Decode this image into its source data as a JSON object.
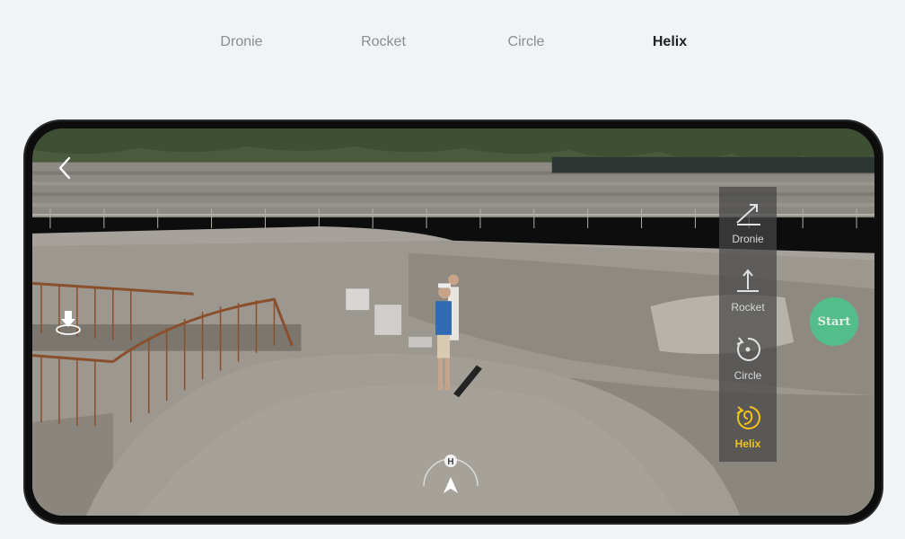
{
  "tabs": [
    {
      "label": "Dronie",
      "active": false
    },
    {
      "label": "Rocket",
      "active": false
    },
    {
      "label": "Circle",
      "active": false
    },
    {
      "label": "Helix",
      "active": true
    }
  ],
  "modes": [
    {
      "label": "Dronie",
      "icon": "dronie-icon",
      "active": false
    },
    {
      "label": "Rocket",
      "icon": "rocket-icon",
      "active": false
    },
    {
      "label": "Circle",
      "icon": "circle-orbit-icon",
      "active": false
    },
    {
      "label": "Helix",
      "icon": "helix-icon",
      "active": true
    }
  ],
  "start_label": "Start",
  "compass_label": "H",
  "colors": {
    "accent_active": "#f3c21b",
    "start_button": "#4fc38a",
    "tab_active": "#222222",
    "tab_inactive": "#8a8d91"
  },
  "icons": {
    "back": "chevron-left-icon",
    "land": "landing-icon",
    "compass": "home-point-compass-icon"
  }
}
